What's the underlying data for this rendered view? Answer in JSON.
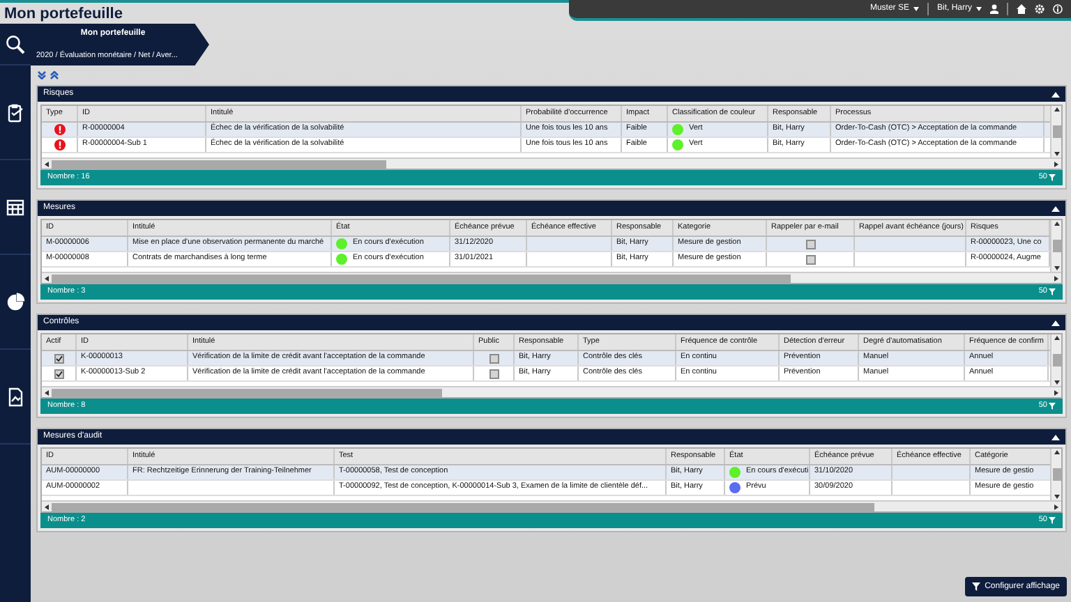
{
  "header": {
    "title": "Mon portefeuille",
    "company": "Muster SE",
    "user": "Bit, Harry"
  },
  "breadcrumb": {
    "title": "Mon portefeuille",
    "path": "2020 / Évaluation monétaire / Net / Aver..."
  },
  "panels": [
    {
      "title": "Risques",
      "count": "Nombre : 16",
      "page_size": "50",
      "columns": [
        "Type",
        "ID",
        "Intitulé",
        "Probabilité d'occurrence",
        "Impact",
        "Classification de couleur",
        "Responsable",
        "Processus"
      ],
      "rows": [
        [
          {
            "kind": "alert"
          },
          "R-00000004",
          "Échec de la vérification de la solvabilité",
          "Une fois tous les 10 ans",
          "Faible",
          {
            "kind": "status",
            "color": "#5ef02a",
            "text": "Vert"
          },
          "Bit, Harry",
          "Order-To-Cash (OTC) > Acceptation de la commande"
        ],
        [
          {
            "kind": "alert"
          },
          "R-00000004-Sub 1",
          "Échec de la vérification de la solvabilité",
          "Une fois tous les 10 ans",
          "Faible",
          {
            "kind": "status",
            "color": "#5ef02a",
            "text": "Vert"
          },
          "Bit, Harry",
          "Order-To-Cash (OTC) > Acceptation de la commande"
        ]
      ]
    },
    {
      "title": "Mesures",
      "count": "Nombre : 3",
      "page_size": "50",
      "columns": [
        "ID",
        "Intitulé",
        "État",
        "Échéance prévue",
        "Échéance effective",
        "Responsable",
        "Kategorie",
        "Rappeler par e-mail",
        "Rappel avant échéance (jours)",
        "Risques"
      ],
      "rows": [
        [
          "M-00000006",
          "Mise en place d'une observation permanente du marché",
          {
            "kind": "status",
            "color": "#5ef02a",
            "text": "En cours d'exécution"
          },
          "31/12/2020",
          null,
          "Bit, Harry",
          "Mesure de gestion",
          {
            "kind": "checkbox",
            "checked": false
          },
          null,
          "R-00000023, Une co"
        ],
        [
          "M-00000008",
          "Contrats de marchandises à long terme",
          {
            "kind": "status",
            "color": "#5ef02a",
            "text": "En cours d'exécution"
          },
          "31/01/2021",
          null,
          "Bit, Harry",
          "Mesure de gestion",
          {
            "kind": "checkbox",
            "checked": false
          },
          null,
          "R-00000024, Augme"
        ]
      ]
    },
    {
      "title": "Contrôles",
      "count": "Nombre : 8",
      "page_size": "50",
      "columns": [
        "Actif",
        "ID",
        "Intitulé",
        "Public",
        "Responsable",
        "Type",
        "Fréquence de contrôle",
        "Détection d'erreur",
        "Degré d'automatisation",
        "Fréquence de confirm"
      ],
      "rows": [
        [
          {
            "kind": "checkbox",
            "checked": true
          },
          "K-00000013",
          "Vérification de la limite de crédit avant l'acceptation de la commande",
          {
            "kind": "checkbox",
            "checked": false
          },
          "Bit, Harry",
          "Contrôle des clés",
          "En continu",
          "Prévention",
          "Manuel",
          "Annuel"
        ],
        [
          {
            "kind": "checkbox",
            "checked": true
          },
          "K-00000013-Sub 2",
          "Vérification de la limite de crédit avant l'acceptation de la commande",
          {
            "kind": "checkbox",
            "checked": false
          },
          "Bit, Harry",
          "Contrôle des clés",
          "En continu",
          "Prévention",
          "Manuel",
          "Annuel"
        ]
      ]
    },
    {
      "title": "Mesures d'audit",
      "count": "Nombre : 2",
      "page_size": "50",
      "columns": [
        "ID",
        "Intitulé",
        "Test",
        "Responsable",
        "État",
        "Échéance prévue",
        "Échéance effective",
        "Catégorie"
      ],
      "rows": [
        [
          "AUM-00000000",
          "FR: Rechtzeitige Erinnerung der Training-Teilnehmer",
          "T-00000058, Test de conception",
          "Bit, Harry",
          {
            "kind": "status",
            "color": "#5ef02a",
            "text": "En cours d'exécuti"
          },
          "31/10/2020",
          null,
          "Mesure de gestio"
        ],
        [
          "AUM-00000002",
          null,
          "T-00000092, Test de conception, K-00000014-Sub 3, Examen de la limite de clientèle déf...",
          "Bit, Harry",
          {
            "kind": "status",
            "color": "#5a6cf0",
            "text": "Prévu"
          },
          "30/09/2020",
          null,
          "Mesure de gestio"
        ]
      ]
    }
  ],
  "configure_button": "Configurer affichage"
}
